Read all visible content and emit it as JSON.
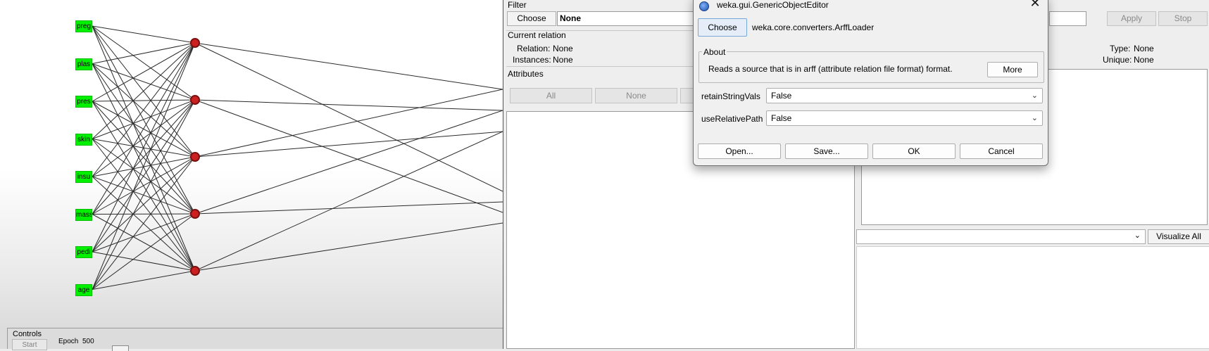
{
  "network": {
    "inputs": [
      "preg",
      "plas",
      "pres",
      "skin",
      "insu",
      "mass",
      "pedi",
      "age"
    ],
    "input_color": "#00f000",
    "hidden_node_color": "#cc2020",
    "hidden_count": 5
  },
  "controls": {
    "title": "Controls",
    "start_label": "Start",
    "epoch_label": "Epoch",
    "epoch_value": "500"
  },
  "explorer": {
    "filter": {
      "legend": "Filter",
      "choose_label": "Choose",
      "value": "None",
      "apply_label": "Apply",
      "stop_label": "Stop"
    },
    "current_relation": {
      "legend": "Current relation",
      "relation_label": "Relation:",
      "relation_value": "None",
      "instances_label": "Instances:",
      "instances_value": "None"
    },
    "attributes": {
      "legend": "Attributes",
      "all_label": "All",
      "none_label": "None"
    },
    "selected_attribute": {
      "type_label": "Type:",
      "type_value": "None",
      "unique_label": "Unique:",
      "unique_value": "None"
    },
    "visualize_all_label": "Visualize All"
  },
  "dialog": {
    "title": "weka.gui.GenericObjectEditor",
    "choose_label": "Choose",
    "class_name": "weka.core.converters.ArffLoader",
    "about_legend": "About",
    "about_text": "Reads a source that is in arff (attribute relation file format) format.",
    "more_label": "More",
    "properties": [
      {
        "name": "retainStringVals",
        "value": "False"
      },
      {
        "name": "useRelativePath",
        "value": "False"
      }
    ],
    "buttons": {
      "open": "Open...",
      "save": "Save...",
      "ok": "OK",
      "cancel": "Cancel"
    }
  }
}
